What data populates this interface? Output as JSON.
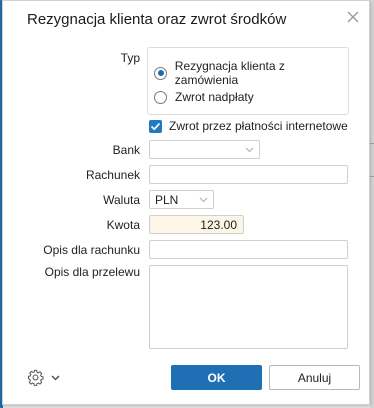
{
  "dialog": {
    "title": "Rezygnacja klienta oraz zwrot środków",
    "close_icon": "close-icon"
  },
  "typ": {
    "label": "Typ",
    "options": [
      {
        "label": "Rezygnacja klienta z zamówienia",
        "selected": true
      },
      {
        "label": "Zwrot nadpłaty",
        "selected": false
      }
    ]
  },
  "online_refund": {
    "label": "Zwrot przez płatności internetowe",
    "checked": true
  },
  "form": {
    "bank": {
      "label": "Bank",
      "value": ""
    },
    "rachunek": {
      "label": "Rachunek",
      "value": ""
    },
    "waluta": {
      "label": "Waluta",
      "value": "PLN"
    },
    "kwota": {
      "label": "Kwota",
      "value": "123.00"
    },
    "opis_rachunku": {
      "label": "Opis dla rachunku",
      "value": ""
    },
    "opis_przelewu": {
      "label": "Opis dla przelewu",
      "value": ""
    }
  },
  "footer": {
    "settings_icon": "gear-icon",
    "ok_label": "OK",
    "cancel_label": "Anuluj"
  },
  "colors": {
    "primary": "#1f6fb5",
    "amount_bg": "#fdf5e6"
  }
}
